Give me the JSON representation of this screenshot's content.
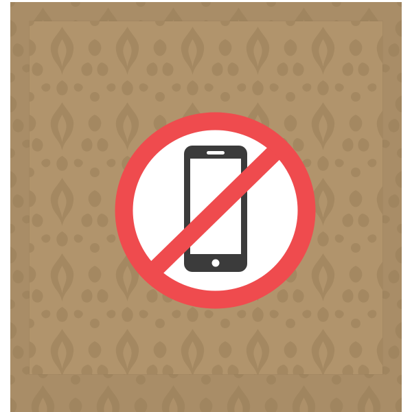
{
  "icon": {
    "name": "no-phone-sign",
    "depicts": "smartphone-icon",
    "prohibition": "prohibition-icon"
  },
  "colors": {
    "background": "#ffffff",
    "panel_outer": "#a98d67",
    "panel_inner": "#b1946c",
    "damask_pattern": "#9a7f59",
    "prohibition_red": "#ef4b4e",
    "sign_fill": "#ffffff",
    "phone_body": "#3b3b3b",
    "phone_screen": "#ffffff"
  }
}
